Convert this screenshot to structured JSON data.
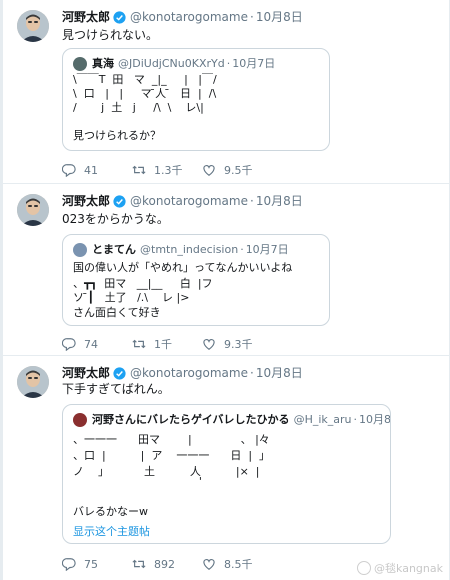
{
  "tweets": [
    {
      "author_name": "河野太郎",
      "handle": "@konotarogomame",
      "dot": "·",
      "time": "10月8日",
      "text": "見つけられない。",
      "quote": {
        "name": "真海",
        "handle": "@JDiUdjCNu0KXrYd",
        "dot": "·",
        "time": "10月7日",
        "lines": [
          "\\￣￣T  田   マ  _|_     |   |￣/",
          "\\  口   |   |     マ ̄人 ̄   日  |  /\\",
          "/       j  土   j     /\\  \\    レ\\|",
          "",
          "見つけられるか？"
        ]
      },
      "replies": "41",
      "retweets": "1.3千",
      "likes": "9.5千"
    },
    {
      "author_name": "河野太郎",
      "handle": "@konotarogomame",
      "dot": "·",
      "time": "10月8日",
      "text": "023をからかうな。",
      "quote": {
        "name": "とまてん",
        "handle": "@tmtn_indecision",
        "dot": "·",
        "time": "10月7日",
        "lines": [
          "国の偉い人が「やめれ」ってなんかいいよね",
          "、┳┓  田マ   __|__     白  |フ",
          "ソ ̄┃   土了   /.\\    レ |>",
          "さん面白くて好き"
        ]
      },
      "replies": "74",
      "retweets": "1千",
      "likes": "9.3千"
    },
    {
      "author_name": "河野太郎",
      "handle": "@konotarogomame",
      "dot": "·",
      "time": "10月8日",
      "text": "下手すぎてばれん。",
      "quote": {
        "name": "河野さんにバレたらゲイバレしたひかる",
        "handle": "@H_ik_aru",
        "dot": "·",
        "time": "10月8日",
        "lines": [
          "、一一一      田マ        |              、 |々",
          "、口  |          |  ア    一一一      日  |  」",
          "ノ    」          土          人          |×  |",
          "                                    '",
          "",
          "バレるかなーw"
        ],
        "show_thread": "显示这个主题帖"
      },
      "replies": "75",
      "retweets": "892",
      "likes": "8.5千"
    }
  ],
  "watermark": "@毯kangnak",
  "colors": {
    "link": "#1b95e0",
    "verified": "#1da1f2",
    "muted": "#657786",
    "border": "#e6ecf0"
  },
  "icons": [
    "reply-icon",
    "retweet-icon",
    "like-icon",
    "verified-icon"
  ]
}
